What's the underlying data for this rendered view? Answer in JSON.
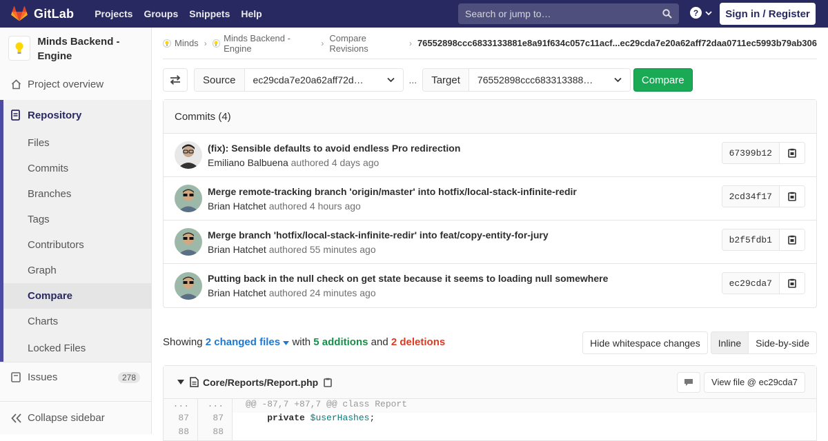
{
  "navbar": {
    "brand": "GitLab",
    "links": [
      "Projects",
      "Groups",
      "Snippets",
      "Help"
    ],
    "search_placeholder": "Search or jump to…",
    "signin_label": "Sign in / Register"
  },
  "sidebar": {
    "project_name": "Minds Backend - Engine",
    "overview": "Project overview",
    "repository": "Repository",
    "repo_items": [
      "Files",
      "Commits",
      "Branches",
      "Tags",
      "Contributors",
      "Graph",
      "Compare",
      "Charts",
      "Locked Files"
    ],
    "active_item": "Compare",
    "issues_label": "Issues",
    "issues_count": "278",
    "collapse_label": "Collapse sidebar"
  },
  "breadcrumbs": {
    "items": [
      "Minds",
      "Minds Backend - Engine",
      "Compare Revisions"
    ],
    "current": "76552898ccc6833133881e8a91f634c057c11acf...ec29cda7e20a62aff72daa0711ec5993b79ab306"
  },
  "compare": {
    "source_label": "Source",
    "source_value": "ec29cda7e20a62aff72d…",
    "separator": "...",
    "target_label": "Target",
    "target_value": "76552898ccc683313388…",
    "compare_button": "Compare"
  },
  "commits": {
    "header": "Commits (4)",
    "authored_word": "authored",
    "rows": [
      {
        "title": "(fix): Sensible defaults to avoid endless Pro redirection",
        "author": "Emiliano Balbuena",
        "time": "4 days ago",
        "sha": "67399b12"
      },
      {
        "title": "Merge remote-tracking branch 'origin/master' into hotfix/local-stack-infinite-redir",
        "author": "Brian Hatchet",
        "time": "4 hours ago",
        "sha": "2cd34f17"
      },
      {
        "title": "Merge branch 'hotfix/local-stack-infinite-redir' into feat/copy-entity-for-jury",
        "author": "Brian Hatchet",
        "time": "55 minutes ago",
        "sha": "b2f5fdb1"
      },
      {
        "title": "Putting back in the null check on get state because it seems to loading null somewhere",
        "author": "Brian Hatchet",
        "time": "24 minutes ago",
        "sha": "ec29cda7"
      }
    ]
  },
  "summary": {
    "showing": "Showing",
    "changed_files": "2 changed files",
    "with": "with",
    "additions": "5 additions",
    "and": "and",
    "deletions": "2 deletions"
  },
  "view_buttons": {
    "whitespace": "Hide whitespace changes",
    "inline": "Inline",
    "side_by_side": "Side-by-side"
  },
  "diff": {
    "file_path": "Core/Reports/Report.php",
    "view_file": "View file @ ec29cda7",
    "hunk": "@@ -87,7 +87,7 @@ class Report",
    "lines": [
      {
        "old": "87",
        "new": "87",
        "keyword": "private",
        "var": "$userHashes",
        "rest": ";"
      },
      {
        "old": "88",
        "new": "88",
        "keyword": "",
        "var": "",
        "rest": ""
      }
    ],
    "ellipsis": "..."
  },
  "colors": {
    "navbar": "#292961",
    "accent_green": "#1aaa55",
    "link_blue": "#1f78d1",
    "deletion_red": "#db3b21"
  }
}
